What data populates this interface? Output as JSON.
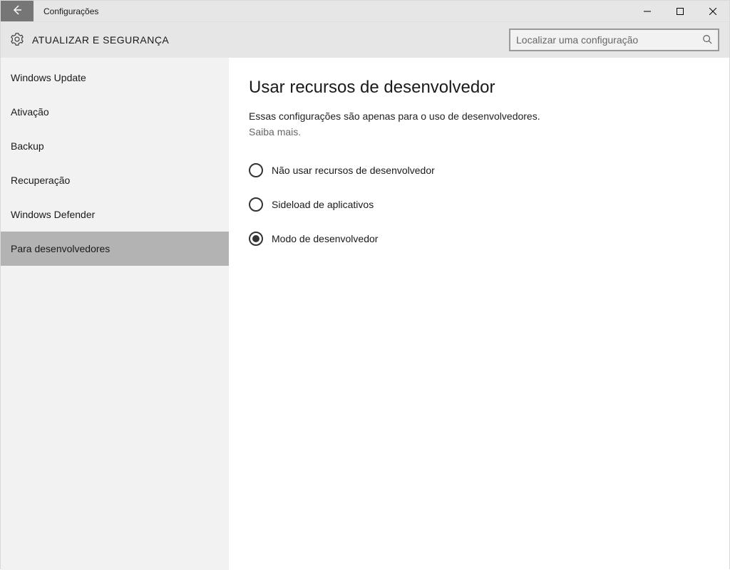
{
  "window": {
    "title": "Configurações"
  },
  "header": {
    "title": "ATUALIZAR E SEGURANÇA",
    "search_placeholder": "Localizar uma configuração"
  },
  "sidebar": {
    "items": [
      {
        "label": "Windows Update",
        "active": false
      },
      {
        "label": "Ativação",
        "active": false
      },
      {
        "label": "Backup",
        "active": false
      },
      {
        "label": "Recuperação",
        "active": false
      },
      {
        "label": "Windows Defender",
        "active": false
      },
      {
        "label": "Para desenvolvedores",
        "active": true
      }
    ]
  },
  "main": {
    "heading": "Usar recursos de desenvolvedor",
    "description": "Essas configurações são apenas para o uso de desenvolvedores.",
    "learn_more": "Saiba mais.",
    "radios": [
      {
        "label": "Não usar recursos de desenvolvedor",
        "selected": false
      },
      {
        "label": "Sideload de aplicativos",
        "selected": false
      },
      {
        "label": "Modo de desenvolvedor",
        "selected": true
      }
    ]
  }
}
